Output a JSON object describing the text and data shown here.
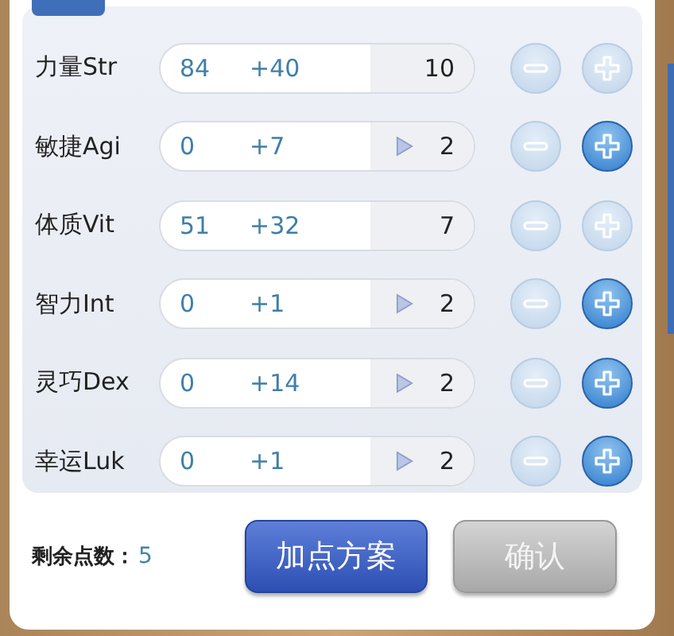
{
  "stats": [
    {
      "label": "力量Str",
      "base": "84",
      "bonus": "+40",
      "marker": false,
      "cost": "10",
      "minus_enabled": false,
      "plus_enabled": false
    },
    {
      "label": "敏捷Agi",
      "base": "0",
      "bonus": "+7",
      "marker": true,
      "cost": "2",
      "minus_enabled": false,
      "plus_enabled": true
    },
    {
      "label": "体质Vit",
      "base": "51",
      "bonus": "+32",
      "marker": false,
      "cost": "7",
      "minus_enabled": false,
      "plus_enabled": false
    },
    {
      "label": "智力Int",
      "base": "0",
      "bonus": "+1",
      "marker": true,
      "cost": "2",
      "minus_enabled": false,
      "plus_enabled": true
    },
    {
      "label": "灵巧Dex",
      "base": "0",
      "bonus": "+14",
      "marker": true,
      "cost": "2",
      "minus_enabled": false,
      "plus_enabled": true
    },
    {
      "label": "幸运Luk",
      "base": "0",
      "bonus": "+1",
      "marker": true,
      "cost": "2",
      "minus_enabled": false,
      "plus_enabled": true
    }
  ],
  "remaining": {
    "label": "剩余点数：",
    "value": "5"
  },
  "buttons": [
    {
      "label": "加点方案",
      "disabled": false
    },
    {
      "label": "确认",
      "disabled": true
    }
  ]
}
